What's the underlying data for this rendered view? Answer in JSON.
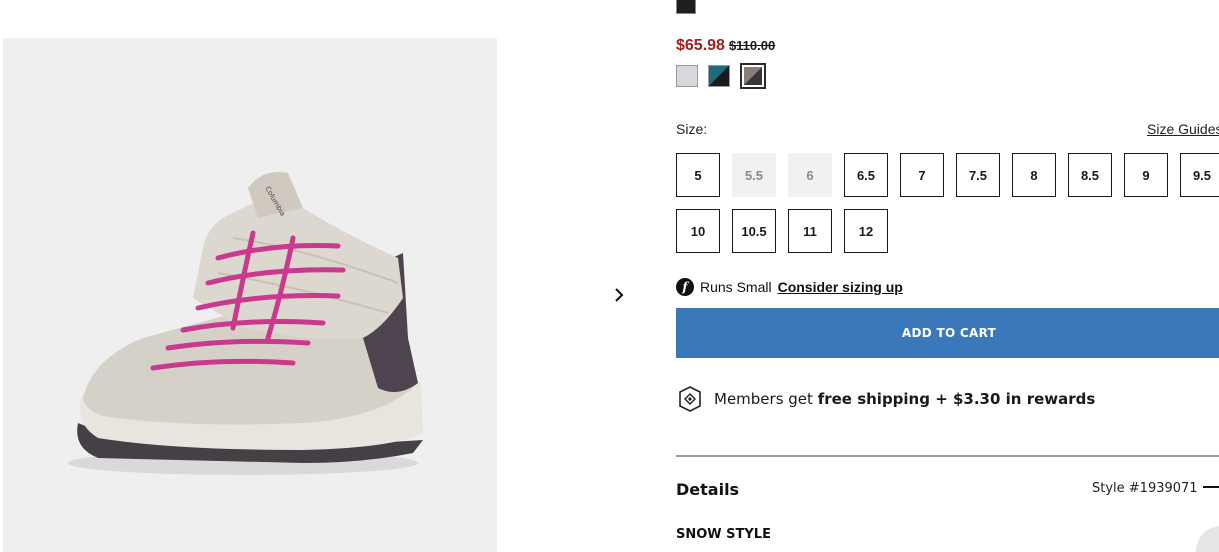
{
  "gallery": {
    "image_alt": "Columbia pink-laced light grey snow boot",
    "next_icon": "chevron-right-icon"
  },
  "product": {
    "price_sale": "$65.98",
    "price_original": "$110.00",
    "colors": {
      "top_swatch": "#1e1e1e",
      "swatches": [
        {
          "name": "light-grey",
          "color": "#d9d8de"
        },
        {
          "name": "teal-black",
          "color": "#1f6a78"
        },
        {
          "name": "stone-taupe",
          "color": "#7c6e6a",
          "selected": true
        }
      ]
    }
  },
  "sizes": {
    "label": "Size:",
    "guide_link": "Size Guides",
    "options": [
      {
        "label": "5",
        "available": true
      },
      {
        "label": "5.5",
        "available": false
      },
      {
        "label": "6",
        "available": false
      },
      {
        "label": "6.5",
        "available": true
      },
      {
        "label": "7",
        "available": true
      },
      {
        "label": "7.5",
        "available": true
      },
      {
        "label": "8",
        "available": true
      },
      {
        "label": "8.5",
        "available": true
      },
      {
        "label": "9",
        "available": true
      },
      {
        "label": "9.5",
        "available": true
      },
      {
        "label": "10",
        "available": true
      },
      {
        "label": "10.5",
        "available": true
      },
      {
        "label": "11",
        "available": true
      },
      {
        "label": "12",
        "available": true
      }
    ]
  },
  "fit": {
    "icon_letter": "f",
    "text": "Runs Small",
    "link": "Consider sizing up"
  },
  "cart": {
    "button_label": "ADD TO CART",
    "button_color": "#3a78b9"
  },
  "members": {
    "prefix": "Members get",
    "highlight": "free shipping + $3.30 in rewards"
  },
  "details": {
    "title": "Details",
    "style_number": "Style #1939071",
    "subheading": "SNOW STYLE"
  },
  "theme": {
    "sale_red": "#a3211f",
    "photo_bg": "#efefef"
  }
}
